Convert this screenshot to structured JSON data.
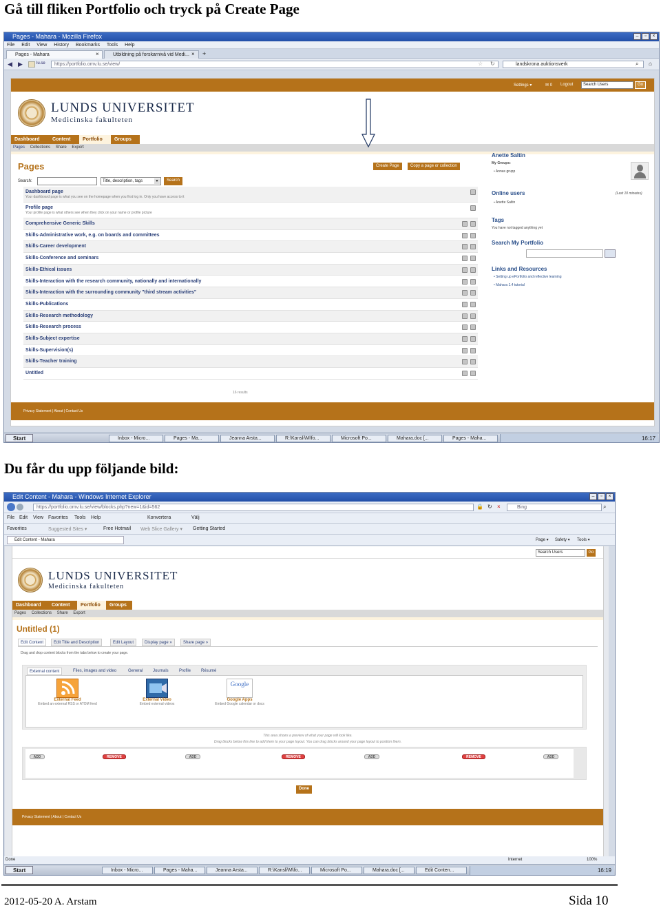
{
  "instructions": {
    "step1": "Gå till fliken Portfolio och tryck på Create Page",
    "step2": "Du får du upp följande bild:"
  },
  "footer": {
    "date_author": "2012-05-20 A. Arstam",
    "page_number": "Sida 10"
  },
  "screenshot1": {
    "window_title": "Pages - Mahara - Mozilla Firefox",
    "menu": [
      "File",
      "Edit",
      "View",
      "History",
      "Bookmarks",
      "Tools",
      "Help"
    ],
    "tabs": [
      "Pages - Mahara",
      "Utbildning på forskarnivå vid Medi..."
    ],
    "tab_close": "×",
    "tab_new": "+",
    "site_badge": "lu.se",
    "url": "https://portfolio.omv.lu.se/view/",
    "search_engine_text": "landskrona auktionsverk",
    "top_links": {
      "settings": "Settings ▾",
      "messages": "✉ 0",
      "logout": "Logout",
      "search_placeholder": "Search Users",
      "go": "Go"
    },
    "logo": {
      "title": "LUNDS UNIVERSITET",
      "subtitle": "Medicinska fakulteten"
    },
    "main_tabs": [
      "Dashboard",
      "Content",
      "Portfolio",
      "Groups"
    ],
    "sub_tabs": [
      "Pages",
      "Collections",
      "Share",
      "Export"
    ],
    "page_heading": "Pages",
    "create_button": "Create Page",
    "copy_button": "Copy a page or collection",
    "search_label": "Search:",
    "search_type": "Title, description, tags",
    "search_button": "Search",
    "pages": [
      {
        "name": "Dashboard page",
        "desc": "Your dashboard page is what you see on the homepage when you first log in. Only you have access to it"
      },
      {
        "name": "Profile page",
        "desc": "Your profile page is what others see when they click on your name or profile picture"
      },
      {
        "name": "Comprehensive Generic Skills",
        "desc": ""
      },
      {
        "name": "Skills-Administrative work, e.g. on boards and committees",
        "desc": ""
      },
      {
        "name": "Skills-Career development",
        "desc": ""
      },
      {
        "name": "Skills-Conference and seminars",
        "desc": ""
      },
      {
        "name": "Skills-Ethical issues",
        "desc": ""
      },
      {
        "name": "Skills-Interaction with the research community, nationally and internationally",
        "desc": ""
      },
      {
        "name": "Skills-Interaction with the surrounding community \"third stream activities\"",
        "desc": ""
      },
      {
        "name": "Skills-Publications",
        "desc": ""
      },
      {
        "name": "Skills-Research methodology",
        "desc": ""
      },
      {
        "name": "Skills-Research process",
        "desc": ""
      },
      {
        "name": "Skills-Subject expertise",
        "desc": ""
      },
      {
        "name": "Skills-Supervision(s)",
        "desc": ""
      },
      {
        "name": "Skills-Teacher training",
        "desc": ""
      },
      {
        "name": "Untitled",
        "desc": ""
      }
    ],
    "results_count": "16 results",
    "sidebar": {
      "user_name": "Anette Saltin",
      "my_groups_label": "My Groups:",
      "group": "Annas grupp",
      "online_users": "Online users",
      "online_window": "(Last 10 minutes)",
      "online_user": "Anette Saltin",
      "tags": "Tags",
      "tags_empty": "You have not tagged anything yet",
      "search_portfolio": "Search My Portfolio",
      "links_resources": "Links and Resources",
      "link1": "Setting up ePortfolio and reflective learning",
      "link2": "Mahara 1.4 tutorial"
    },
    "page_footer": "Privacy Statement  |  About  |  Contact Us",
    "taskbar": {
      "start": "Start",
      "items": [
        "Inbox - Micro...",
        "Pages - Ma...",
        "Jeanna Arsta...",
        "R:\\Kansli\\M\\fo...",
        "Microsoft Po...",
        "Mahara.doc [...",
        "Pages - Maha..."
      ],
      "clock": "16:17"
    }
  },
  "screenshot2": {
    "window_title": "Edit Content - Mahara - Windows Internet Explorer",
    "url": "https://portfolio.omv.lu.se/view/blocks.php?new=1&id=562",
    "search_engine": "Bing",
    "menu": [
      "File",
      "Edit",
      "View",
      "Favorites",
      "Tools",
      "Help"
    ],
    "convert": "Konvertera",
    "select": "Välj",
    "favorites": [
      "Favorites",
      "Suggested Sites ▾",
      "Free Hotmail",
      "Web Slice Gallery ▾",
      "Getting Started"
    ],
    "tab_label": "Edit Content - Mahara",
    "ie_commands": [
      "Page ▾",
      "Safety ▾",
      "Tools ▾"
    ],
    "search_users": "Search Users",
    "go": "Go",
    "logo": {
      "title": "LUNDS UNIVERSITET",
      "subtitle": "Medicinska fakulteten"
    },
    "main_tabs": [
      "Dashboard",
      "Content",
      "Portfolio",
      "Groups"
    ],
    "sub_tabs": [
      "Pages",
      "Collections",
      "Share",
      "Export"
    ],
    "page_heading": "Untitled (1)",
    "edit_tabs": [
      "Edit Content",
      "Edit Title and Description",
      "Edit Layout",
      "Display page »",
      "Share page »"
    ],
    "instruction": "Drag and drop content blocks from the tabs below to create your page.",
    "category_tabs": [
      "External content",
      "Files, images and video",
      "General",
      "Journals",
      "Profile",
      "Résumé"
    ],
    "blocks": [
      {
        "title": "External Feed",
        "desc": "Embed an external RSS or ATOM feed"
      },
      {
        "title": "External Video",
        "desc": "Embed external videos"
      },
      {
        "title": "Google Apps",
        "desc": "Embed Google calendar or docs"
      }
    ],
    "google_logo_text": "Google",
    "preview_note1": "This area shows a preview of what your page will look like.",
    "preview_note2": "Drag blocks below this line to add them to your page layout. You can drag blocks around your page layout to position them.",
    "add_label": "ADD",
    "remove_label": "REMOVE",
    "done": "Done",
    "page_footer": "Privacy Statement  |  About  |  Contact Us",
    "status_done": "Done",
    "status_zone": "Internet",
    "zoom": "100%",
    "taskbar": {
      "start": "Start",
      "items": [
        "Inbox - Micro...",
        "Pages - Maha...",
        "Jeanna Arsta...",
        "R:\\Kansli\\M\\fo...",
        "Microsoft Po...",
        "Mahara.doc [...",
        "Edit Conten..."
      ],
      "clock": "16:19"
    }
  }
}
